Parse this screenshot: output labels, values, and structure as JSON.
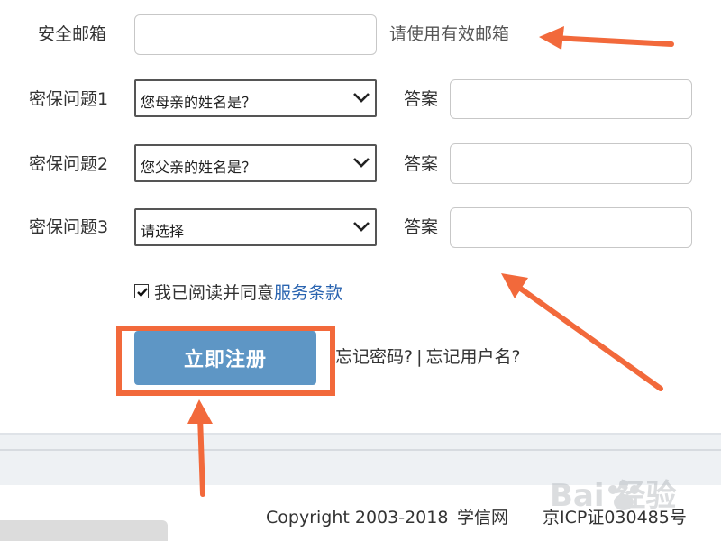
{
  "form": {
    "email": {
      "label": "安全邮箱",
      "value": "",
      "hint": "请使用有效邮箱"
    },
    "questions": [
      {
        "label": "密保问题1",
        "selected": "您母亲的姓名是？",
        "answer_label": "答案",
        "answer_value": ""
      },
      {
        "label": "密保问题2",
        "selected": "您父亲的姓名是？",
        "answer_label": "答案",
        "answer_value": ""
      },
      {
        "label": "密保问题3",
        "selected": "请选择",
        "answer_label": "答案",
        "answer_value": ""
      }
    ],
    "agreement": {
      "checked": true,
      "text": "我已阅读并同意",
      "link_text": "服务条款"
    },
    "register_button": "立即注册",
    "forgot_password": "忘记密码?",
    "separator": "|",
    "forgot_username": "忘记用户名?"
  },
  "footer": {
    "copyright": "Copyright 2003-2018",
    "site_name": "学信网",
    "icp": "京ICP证030485号"
  },
  "watermark": {
    "text": "Bai 经验",
    "icon": "baidu-paw-icon"
  },
  "colors": {
    "accent_button": "#5e96c5",
    "annotation_orange": "#f2693b",
    "link_blue": "#2a64b0"
  }
}
